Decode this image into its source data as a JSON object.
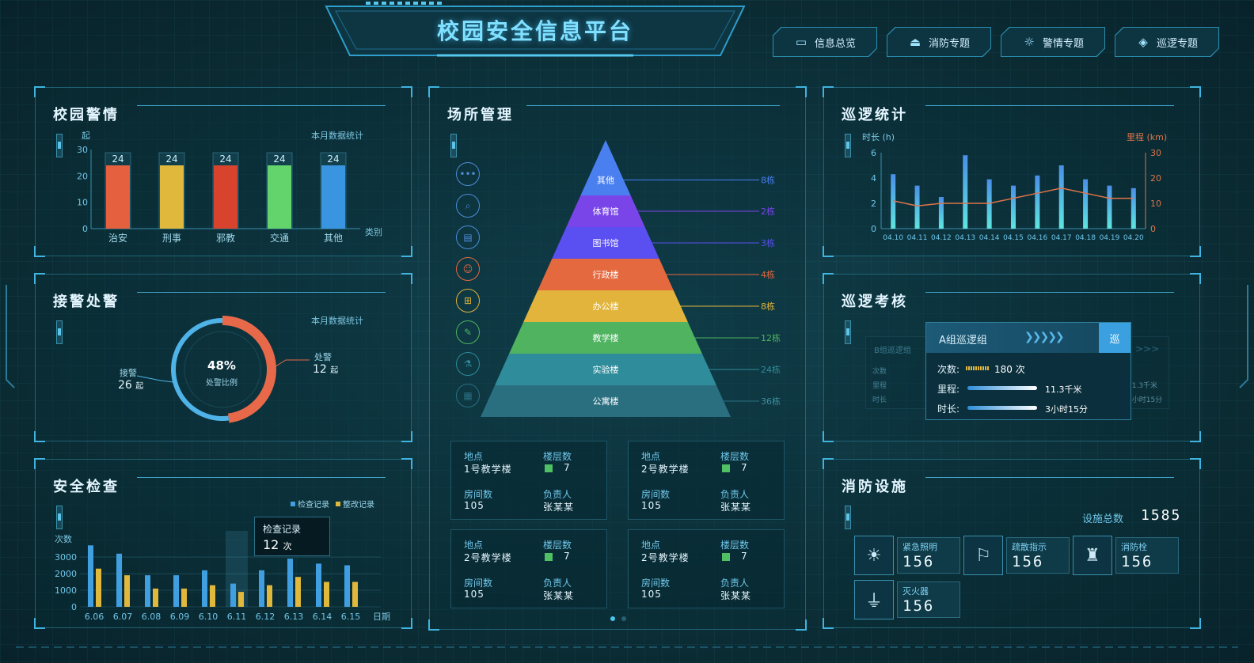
{
  "app_title": "校园安全信息平台",
  "nav": [
    {
      "label": "信息总览",
      "icon": "monitor-icon"
    },
    {
      "label": "消防专题",
      "icon": "fire-extinguisher-icon"
    },
    {
      "label": "警情专题",
      "icon": "alarm-light-icon"
    },
    {
      "label": "巡逻专题",
      "icon": "map-pin-icon"
    }
  ],
  "alerts": {
    "title": "校园警情",
    "y_unit": "起",
    "subtitle": "本月数据统计",
    "x_label": "类别",
    "chart_data": {
      "type": "bar",
      "categories": [
        "治安",
        "刑事",
        "邪教",
        "交通",
        "其他"
      ],
      "values": [
        24,
        24,
        24,
        24,
        24
      ],
      "ylim": [
        0,
        30
      ],
      "yticks": [
        0,
        10,
        20,
        30
      ],
      "colors": [
        "#e5603f",
        "#e0b83b",
        "#d8432d",
        "#63d36b",
        "#3a95e0"
      ]
    }
  },
  "dispatch": {
    "title": "接警处警",
    "subtitle": "本月数据统计",
    "center_value": "48%",
    "center_label": "处警比例",
    "left_label": "接警",
    "left_value": "26",
    "left_unit": "起",
    "right_label": "处警",
    "right_value": "12",
    "right_unit": "起",
    "chart_data": {
      "type": "pie",
      "values": [
        48,
        52
      ],
      "labels": [
        "处警",
        "接警"
      ],
      "colors": [
        "#e8694a",
        "#4fb3e8"
      ]
    }
  },
  "inspection": {
    "title": "安全检查",
    "y_unit": "次数",
    "x_unit": "日期",
    "legend": [
      "检查记录",
      "整改记录"
    ],
    "tooltip_label": "检查记录",
    "tooltip_value": "12",
    "tooltip_unit": "次",
    "chart_data": {
      "type": "bar",
      "categories": [
        "6.06",
        "6.07",
        "6.08",
        "6.09",
        "6.10",
        "6.11",
        "6.12",
        "6.13",
        "6.14",
        "6.15"
      ],
      "series": [
        {
          "name": "检查记录",
          "values": [
            3700,
            3200,
            1900,
            1900,
            2200,
            1400,
            2200,
            2900,
            2600,
            2500
          ],
          "color": "#3f9fe0"
        },
        {
          "name": "整改记录",
          "values": [
            2300,
            1900,
            1100,
            1100,
            1300,
            900,
            1300,
            1800,
            1500,
            1500
          ],
          "color": "#e0b83b"
        }
      ],
      "ylim": [
        0,
        4000
      ],
      "yticks": [
        0,
        1000,
        2000,
        3000
      ]
    }
  },
  "venues": {
    "title": "场所管理",
    "levels": [
      {
        "name": "其他",
        "count": "8栋",
        "color": "#4a7ff0"
      },
      {
        "name": "体育馆",
        "count": "2栋",
        "color": "#7a45e8"
      },
      {
        "name": "图书馆",
        "count": "3栋",
        "color": "#5a4ff0"
      },
      {
        "name": "行政楼",
        "count": "4栋",
        "color": "#e5693f"
      },
      {
        "name": "办公楼",
        "count": "8栋",
        "color": "#e2b43b"
      },
      {
        "name": "教学楼",
        "count": "12栋",
        "color": "#4fb360"
      },
      {
        "name": "实验楼",
        "count": "24栋",
        "color": "#2f8c9a"
      },
      {
        "name": "公寓楼",
        "count": "36栋",
        "color": "#2a6f80"
      }
    ],
    "side_icons": [
      "more-icon",
      "search-icon",
      "document-icon",
      "person-icon",
      "briefcase-icon",
      "pencil-icon",
      "flask-icon",
      "printer-icon"
    ],
    "card_keys": {
      "location": "地点",
      "floors": "楼层数",
      "rooms": "房间数",
      "owner": "负责人"
    },
    "cards": [
      {
        "location": "1号教学楼",
        "floors": "7",
        "rooms": "105",
        "owner": "张某某"
      },
      {
        "location": "2号教学楼",
        "floors": "7",
        "rooms": "105",
        "owner": "张某某"
      },
      {
        "location": "2号教学楼",
        "floors": "7",
        "rooms": "105",
        "owner": "张某某"
      },
      {
        "location": "2号教学楼",
        "floors": "7",
        "rooms": "105",
        "owner": "张某某"
      }
    ]
  },
  "patrol_stats": {
    "title": "巡逻统计",
    "left_axis": "时长 (h)",
    "right_axis": "里程 (km)",
    "chart_data": {
      "type": "bar",
      "categories": [
        "04.10",
        "04.11",
        "04.12",
        "04.13",
        "04.14",
        "04.15",
        "04.16",
        "04.17",
        "04.18",
        "04.19",
        "04.20"
      ],
      "series": [
        {
          "name": "时长 (h)",
          "values": [
            4.3,
            3.4,
            2.5,
            5.8,
            3.9,
            3.4,
            4.2,
            5.0,
            3.9,
            3.4,
            3.2
          ]
        },
        {
          "name": "里程 (km)",
          "type": "line",
          "values": [
            11,
            9,
            10,
            10,
            10,
            12,
            14,
            16,
            14,
            12,
            12
          ]
        }
      ],
      "ylim": [
        0,
        6
      ],
      "yticks": [
        0,
        2,
        4,
        6
      ],
      "y2lim": [
        0,
        30
      ],
      "y2ticks": [
        0,
        10,
        20,
        30
      ]
    }
  },
  "patrol_assess": {
    "title": "巡逻考核",
    "group": "A组巡逻组",
    "badge": "巡",
    "rows": [
      {
        "label": "次数:",
        "value": "180",
        "unit": "次"
      },
      {
        "label": "里程:",
        "value": "11.3千米"
      },
      {
        "label": "时长:",
        "value": "3小时15分"
      }
    ],
    "ghost_rows": [
      {
        "label": "次数"
      },
      {
        "label": "里程"
      },
      {
        "label": "时长"
      }
    ],
    "ghost_right": [
      "11.3千米",
      "3小时15分"
    ],
    "ghost_group": "B组巡逻组"
  },
  "fire": {
    "title": "消防设施",
    "total_label": "设施总数",
    "total_value": "1585",
    "items": [
      {
        "label": "紧急照明",
        "value": "156",
        "icon": "lightbulb-icon"
      },
      {
        "label": "疏散指示",
        "value": "156",
        "icon": "exit-sign-icon"
      },
      {
        "label": "消防栓",
        "value": "156",
        "icon": "hydrant-icon"
      },
      {
        "label": "灭火器",
        "value": "156",
        "icon": "extinguisher-icon"
      }
    ]
  }
}
